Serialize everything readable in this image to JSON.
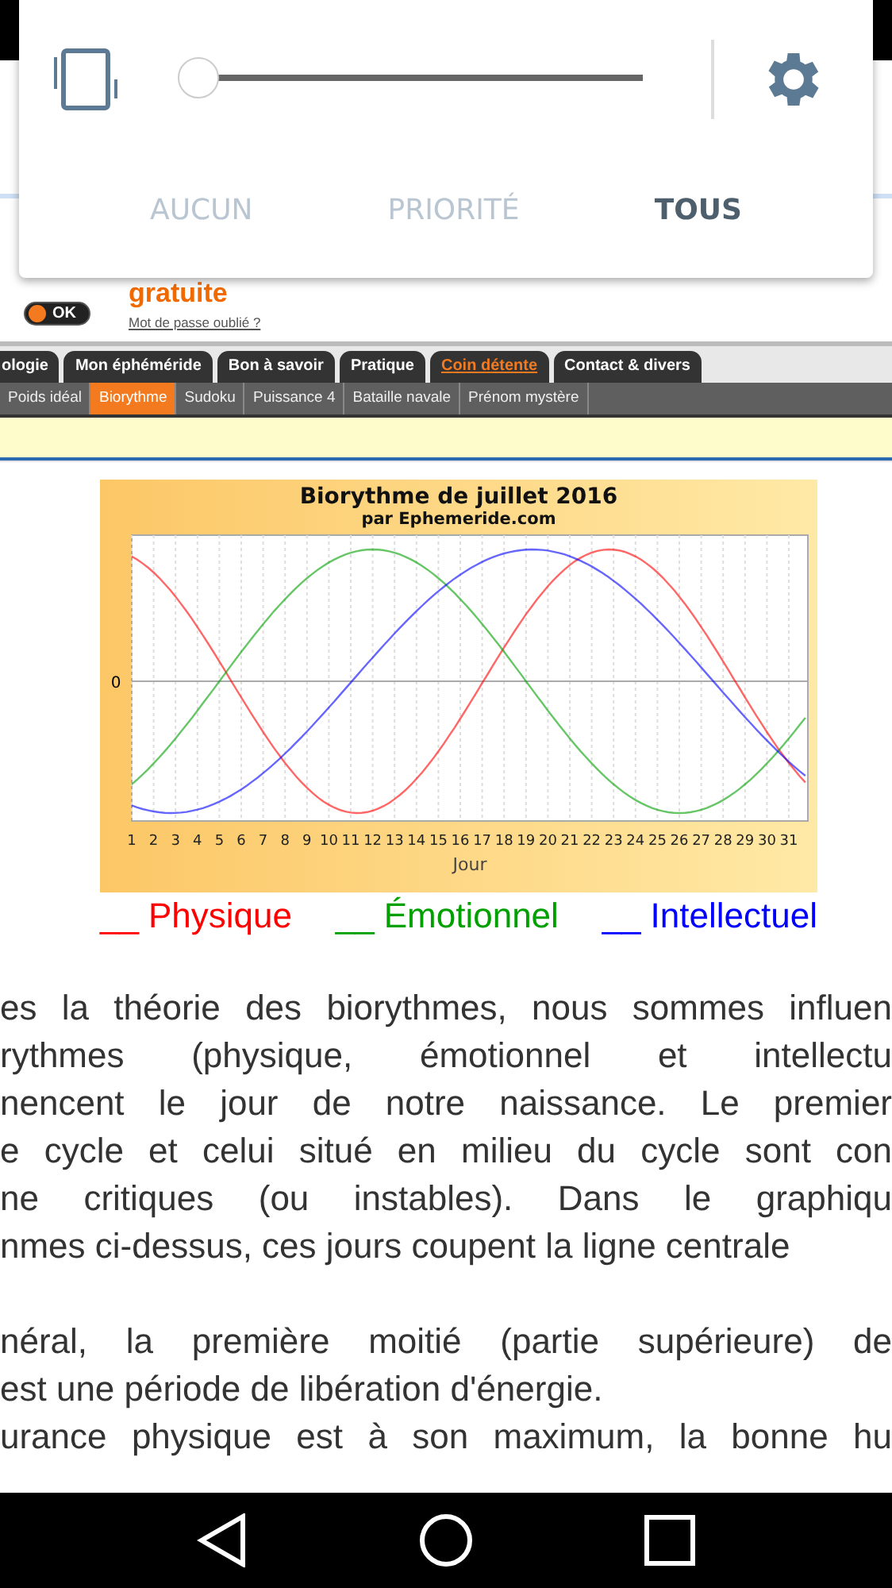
{
  "sound_panel": {
    "volume": {
      "level": 0
    },
    "modes": [
      {
        "label": "AUCUN",
        "selected": false
      },
      {
        "label": "PRIORITÉ",
        "selected": false
      },
      {
        "label": "TOUS",
        "selected": true
      }
    ]
  },
  "login": {
    "headline": "gratuite",
    "forgot_link": "Mot de passe oublié ?",
    "ok_button": "OK"
  },
  "menu_tabs": [
    {
      "label": "ologie",
      "selected": false
    },
    {
      "label": "Mon éphéméride",
      "selected": false
    },
    {
      "label": "Bon à savoir",
      "selected": false
    },
    {
      "label": "Pratique",
      "selected": false
    },
    {
      "label": "Coin détente",
      "selected": true
    },
    {
      "label": "Contact & divers",
      "selected": false
    }
  ],
  "submenu": [
    {
      "label": "Poids idéal",
      "selected": false
    },
    {
      "label": "Biorythme",
      "selected": true
    },
    {
      "label": "Sudoku",
      "selected": false
    },
    {
      "label": "Puissance 4",
      "selected": false
    },
    {
      "label": "Bataille navale",
      "selected": false
    },
    {
      "label": "Prénom mystère",
      "selected": false
    }
  ],
  "chart": {
    "title": "Biorythme de juillet 2016",
    "subtitle": "par Ephemeride.com",
    "y_tick_label": "0",
    "x_axis_label": "Jour",
    "x_tick_labels": [
      "1",
      "2",
      "3",
      "4",
      "5",
      "6",
      "7",
      "8",
      "9",
      "10",
      "11",
      "12",
      "13",
      "14",
      "15",
      "16",
      "17",
      "18",
      "19",
      "20",
      "21",
      "22",
      "23",
      "24",
      "25",
      "26",
      "27",
      "28",
      "29",
      "30",
      "31"
    ]
  },
  "legend": [
    {
      "marker": "__",
      "label": "Physique",
      "color": "#ff0000"
    },
    {
      "marker": "__",
      "label": "Émotionnel",
      "color": "#00a000"
    },
    {
      "marker": "__",
      "label": "Intellectuel",
      "color": "#0000ff"
    }
  ],
  "paragraphs": [
    {
      "lines": [
        "es la théorie des biorythmes, nous sommes influen",
        "rythmes (physique, émotionnel et intellectu",
        "nencent le jour de notre naissance. Le premier",
        "e cycle et celui situé en milieu du cycle sont con",
        "ne critiques (ou instables). Dans le graphiqu",
        "nmes ci-dessus, ces jours coupent la ligne centrale"
      ]
    },
    {
      "lines": [
        "néral, la première moitié (partie supérieure) de",
        "est une période de libération d'énergie."
      ]
    },
    {
      "lines": [
        "urance physique est à son maximum, la bonne hu"
      ]
    }
  ]
}
